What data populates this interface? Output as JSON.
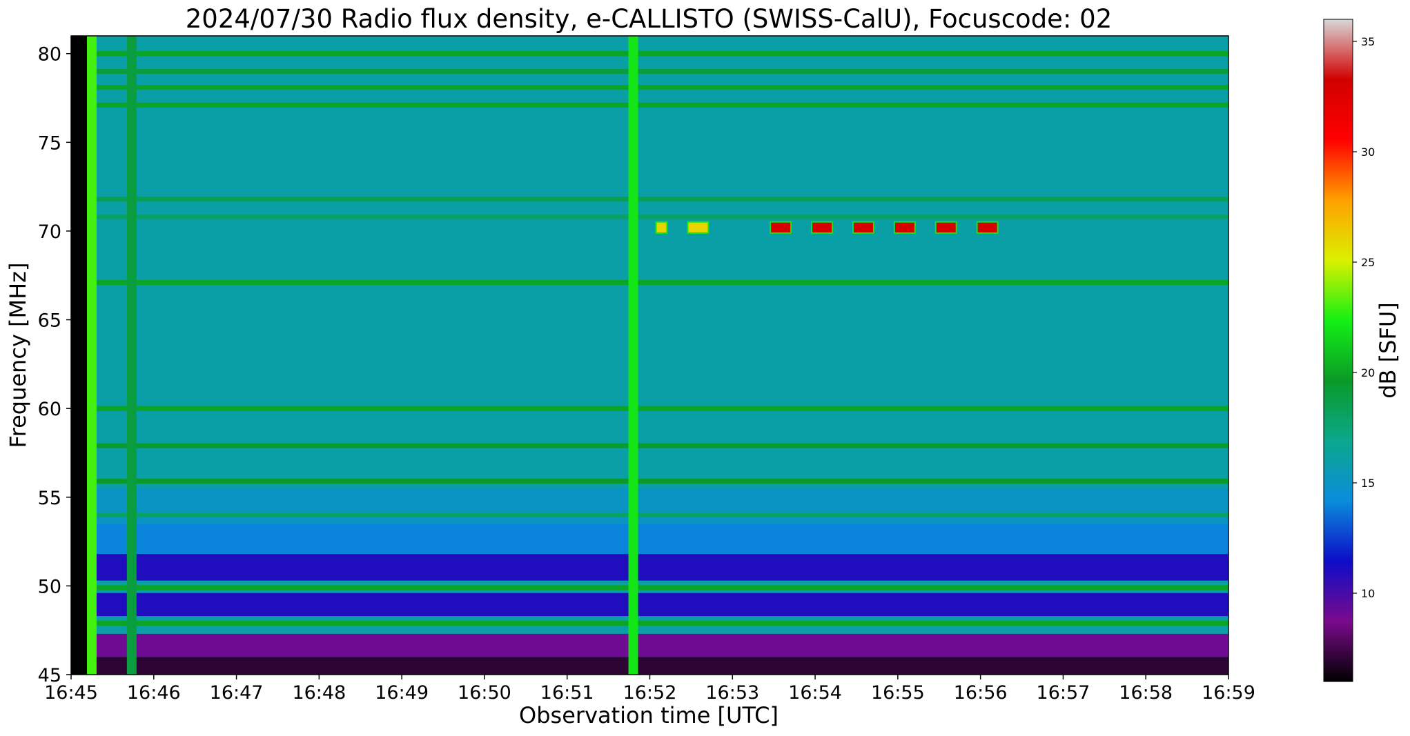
{
  "chart_data": {
    "type": "heatmap",
    "title": "2024/07/30  Radio flux density, e-CALLISTO (SWISS-CalU), Focuscode: 02",
    "xlabel": "Observation time [UTC]",
    "ylabel": "Frequency [MHz]",
    "colorbar_label": "dB [SFU]",
    "x_ticks": [
      "16:45",
      "16:46",
      "16:47",
      "16:48",
      "16:49",
      "16:50",
      "16:51",
      "16:52",
      "16:53",
      "16:54",
      "16:55",
      "16:56",
      "16:57",
      "16:58",
      "16:59"
    ],
    "x_range": [
      "16:45",
      "16:59"
    ],
    "y_ticks": [
      45,
      50,
      55,
      60,
      65,
      70,
      75,
      80
    ],
    "y_range": [
      45,
      81
    ],
    "colorbar_ticks": [
      10,
      15,
      20,
      25,
      30,
      35
    ],
    "colorbar_range": [
      6,
      36
    ],
    "colormap": [
      "#000000",
      "#7a0a8c",
      "#0d0dc8",
      "#0a8cdc",
      "#0aa88c",
      "#0a9a28",
      "#14f014",
      "#dcf000",
      "#ffa000",
      "#ff0000",
      "#d20000",
      "#d8d8d8"
    ],
    "background_level_db": 16,
    "horizontal_bands": [
      {
        "freq_mhz": 80.0,
        "db": 20
      },
      {
        "freq_mhz": 79.0,
        "db": 19
      },
      {
        "freq_mhz": 78.1,
        "db": 20
      },
      {
        "freq_mhz": 77.1,
        "db": 20
      },
      {
        "freq_mhz": 71.8,
        "db": 18.5
      },
      {
        "freq_mhz": 70.8,
        "db": 18
      },
      {
        "freq_mhz": 67.1,
        "db": 20
      },
      {
        "freq_mhz": 60.0,
        "db": 20
      },
      {
        "freq_mhz": 57.9,
        "db": 19.5
      },
      {
        "freq_mhz": 55.9,
        "db": 19.5
      },
      {
        "freq_mhz": 54.0,
        "db": 18
      },
      {
        "freq_mhz": 49.9,
        "db": 20
      },
      {
        "freq_mhz": 47.9,
        "db": 20
      }
    ],
    "low_frequency_zones": [
      {
        "from_mhz": 45.0,
        "to_mhz": 46.0,
        "db": 7
      },
      {
        "from_mhz": 46.0,
        "to_mhz": 47.3,
        "db": 9
      },
      {
        "from_mhz": 48.3,
        "to_mhz": 49.6,
        "db": 11
      },
      {
        "from_mhz": 50.3,
        "to_mhz": 51.8,
        "db": 11
      },
      {
        "from_mhz": 51.8,
        "to_mhz": 53.5,
        "db": 14
      },
      {
        "from_mhz": 53.5,
        "to_mhz": 55.5,
        "db": 15
      }
    ],
    "vertical_bursts": [
      {
        "time": "16:45:05",
        "db": 0
      },
      {
        "time": "16:45:15",
        "db": 23
      },
      {
        "time": "16:45:44",
        "db": 19
      },
      {
        "time": "16:51:48",
        "db": 22
      }
    ],
    "spots": [
      {
        "time_start": "16:52:05",
        "time_end": "16:52:12",
        "freq_mhz": 70.2,
        "db": 26
      },
      {
        "time_start": "16:52:28",
        "time_end": "16:52:42",
        "freq_mhz": 70.2,
        "db": 26
      },
      {
        "time_start": "16:53:28",
        "time_end": "16:53:42",
        "freq_mhz": 70.2,
        "db": 33
      },
      {
        "time_start": "16:53:58",
        "time_end": "16:54:12",
        "freq_mhz": 70.2,
        "db": 33
      },
      {
        "time_start": "16:54:28",
        "time_end": "16:54:42",
        "freq_mhz": 70.2,
        "db": 33
      },
      {
        "time_start": "16:54:58",
        "time_end": "16:55:12",
        "freq_mhz": 70.2,
        "db": 33
      },
      {
        "time_start": "16:55:28",
        "time_end": "16:55:42",
        "freq_mhz": 70.2,
        "db": 33
      },
      {
        "time_start": "16:55:58",
        "time_end": "16:56:12",
        "freq_mhz": 70.2,
        "db": 33
      }
    ]
  }
}
